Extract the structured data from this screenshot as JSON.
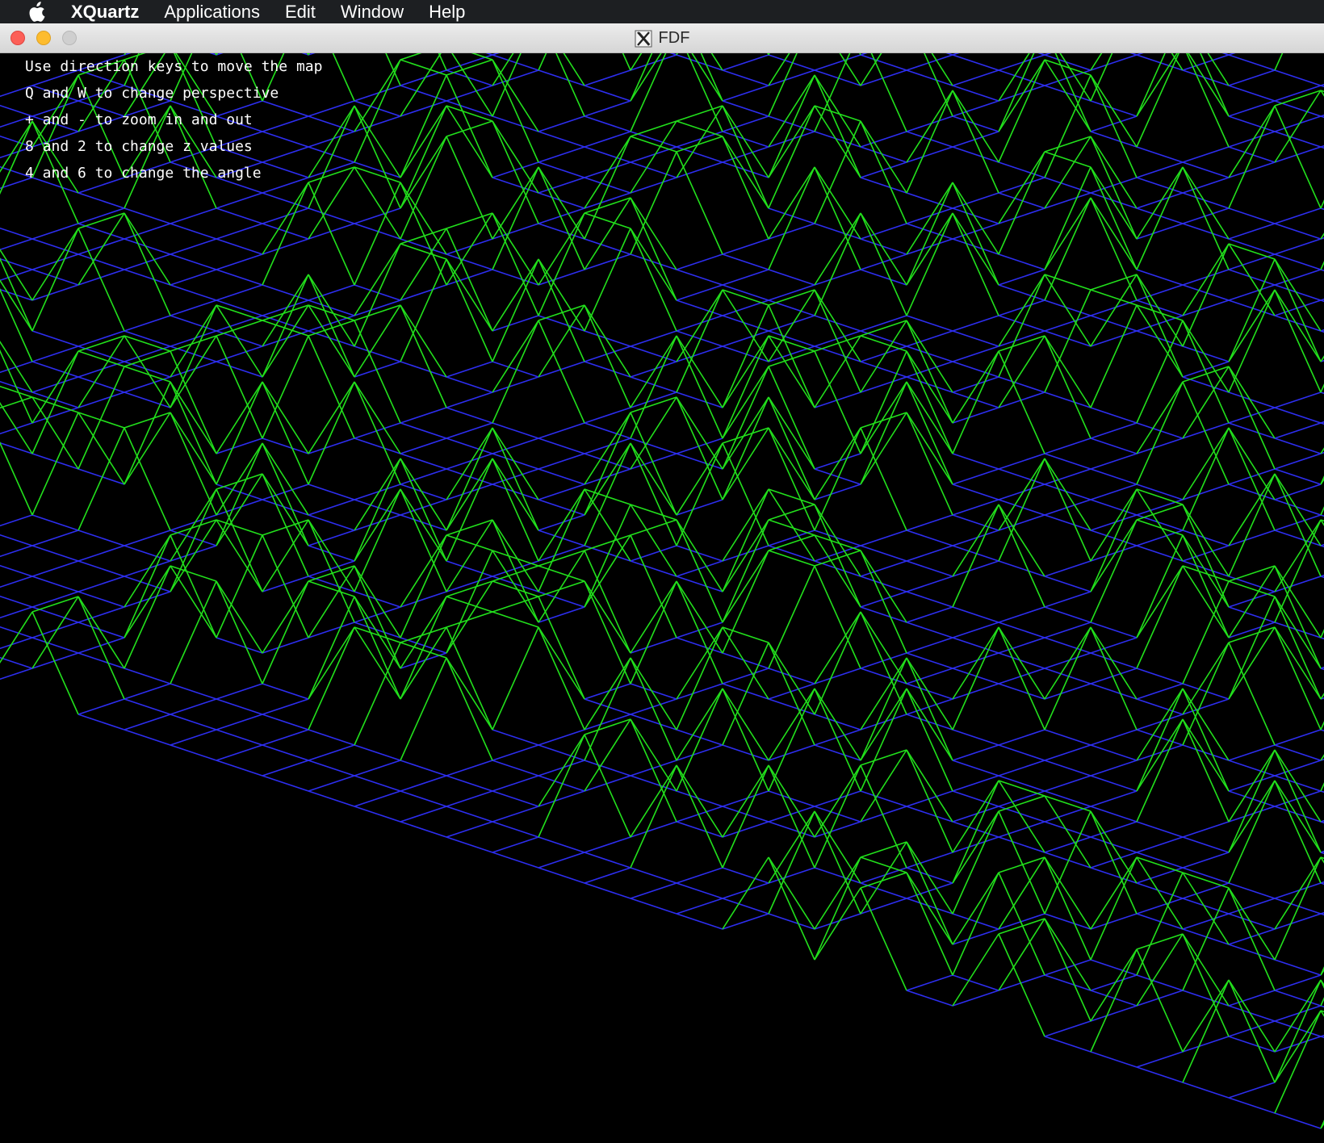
{
  "menubar": {
    "items": [
      {
        "label": "XQuartz"
      },
      {
        "label": "Applications"
      },
      {
        "label": "Edit"
      },
      {
        "label": "Window"
      },
      {
        "label": "Help"
      }
    ]
  },
  "window": {
    "title": "FDF"
  },
  "help_lines": [
    "Use direction keys to move the map",
    "Q and W to change perspective",
    "+ and - to zoom in and out",
    "8 and 2 to change z values",
    "4 and 6 to change the angle"
  ],
  "colors": {
    "peak": "#22e01c",
    "base": "#2d2ef0",
    "background": "#000000"
  }
}
